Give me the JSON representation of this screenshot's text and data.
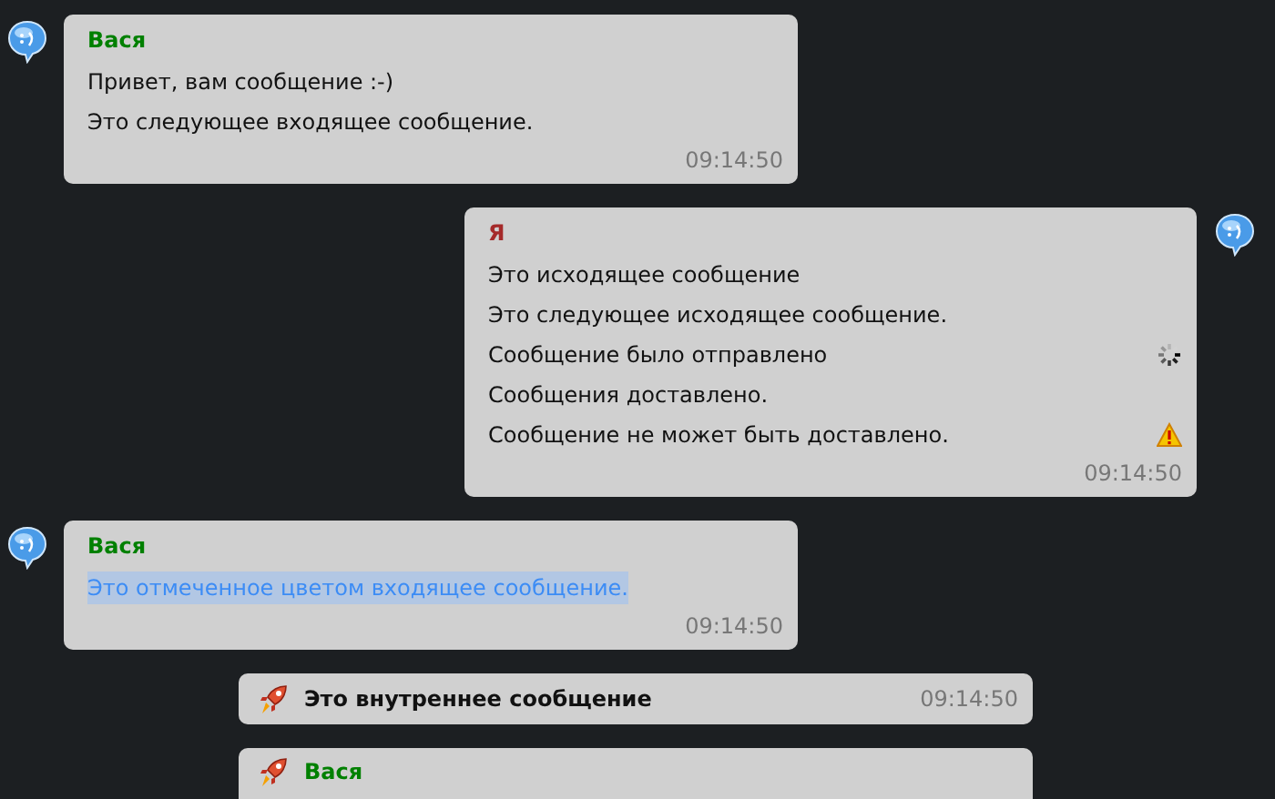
{
  "messages": [
    {
      "kind": "incoming",
      "sender": "Вася",
      "color": "#008000",
      "lines": [
        {
          "text": "Привет, вам сообщение :-)",
          "highlighted": false,
          "sending": false,
          "undelivered": false
        },
        {
          "text": "Это следующее входящее сообщение.",
          "highlighted": false,
          "sending": false,
          "undelivered": false
        }
      ],
      "time": "09:14:50"
    },
    {
      "kind": "outgoing",
      "sender": "Я",
      "color": "#a52a2a",
      "lines": [
        {
          "text": "Это исходящее сообщение",
          "highlighted": false,
          "sending": false,
          "undelivered": false
        },
        {
          "text": "Это следующее исходящее сообщение.",
          "highlighted": false,
          "sending": false,
          "undelivered": false
        },
        {
          "text": "Сообщение было отправлено",
          "highlighted": false,
          "sending": true,
          "undelivered": false
        },
        {
          "text": "Сообщения доставлено.",
          "highlighted": false,
          "sending": false,
          "undelivered": false
        },
        {
          "text": "Сообщение не может быть доставлено.",
          "highlighted": false,
          "sending": false,
          "undelivered": true
        }
      ],
      "time": "09:14:50"
    },
    {
      "kind": "incoming",
      "sender": "Вася",
      "color": "#008000",
      "lines": [
        {
          "text": "Это отмеченное цветом входящее сообщение.",
          "highlighted": true,
          "sending": false,
          "undelivered": false
        }
      ],
      "time": "09:14:50"
    },
    {
      "kind": "internal",
      "text": "Это внутреннее сообщение",
      "time": "09:14:50"
    },
    {
      "kind": "action",
      "sender": "Вася",
      "color": "#008000"
    }
  ]
}
